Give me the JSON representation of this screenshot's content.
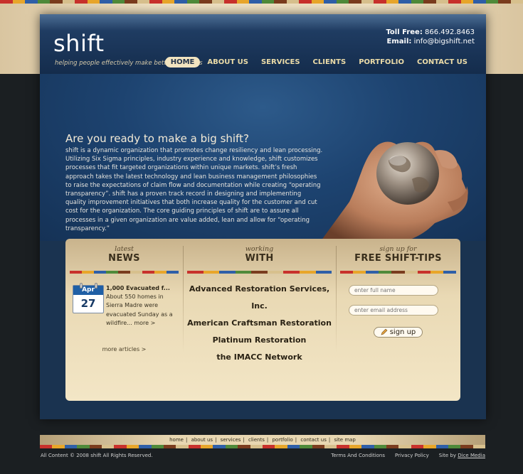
{
  "brand": {
    "logo": "shift",
    "tagline": "helping people effectively make better decisions"
  },
  "contact": {
    "phone_label": "Toll Free:",
    "phone": "866.492.8463",
    "email_label": "Email:",
    "email": "info@bigshift.net"
  },
  "nav": {
    "items": [
      "HOME",
      "ABOUT US",
      "SERVICES",
      "CLIENTS",
      "PORTFOLIO",
      "CONTACT US"
    ],
    "active": "HOME"
  },
  "hero": {
    "title": "Are you ready to make a big shift?",
    "body": "shift is a dynamic organization that promotes change resiliency and lean processing. Utilizing Six Sigma principles, industry experience and knowledge, shift customizes processes that fit targeted organizations within unique markets. shift’s fresh approach takes the latest technology and lean business management philosophies to raise the expectations of claim flow and documentation while creating “operating transparency”. shift has a proven track record in designing and implementing quality improvement initiatives that both increase quality for the customer and cut cost for the organization. The core guiding principles of shift are to assure all processes in a given organization are value added, lean and allow for “operating transparency.”"
  },
  "news": {
    "small": "latest",
    "big": "NEWS",
    "month": "Apr",
    "day": "27",
    "title": "1,000 Evacuated f...",
    "body": "About 550 homes in Sierra Madre were evacuated Sunday as a wildfire...",
    "more_link": "more >",
    "more_articles": "more articles >"
  },
  "working": {
    "small": "working",
    "big": "WITH",
    "clients": [
      "Advanced Restoration Services, Inc.",
      "American Craftsman Restoration",
      "Platinum Restoration",
      "the IMACC Network"
    ]
  },
  "tips": {
    "small": "sign up for",
    "big": "FREE SHIFT-TIPS",
    "name_placeholder": "enter full name",
    "email_placeholder": "enter email address",
    "signup_label": "sign up"
  },
  "footer": {
    "links": [
      "home",
      "about us",
      "services",
      "clients",
      "portfolio",
      "contact us",
      "site map"
    ],
    "copyright": "All Content © 2008 shift All Rights Reserved.",
    "terms": "Terms And Conditions",
    "privacy": "Privacy Policy",
    "site_by_label": "Site by",
    "site_by": "Dice Media"
  },
  "colors": {
    "stripe": [
      "#c8312c",
      "#e8a62a",
      "#2f5fa8",
      "#4f8a3a",
      "#7a3c1e",
      "#d7c08d"
    ],
    "navy": "#1a3350",
    "cream": "#f3e6c6",
    "nav_text": "#ecdca8"
  }
}
